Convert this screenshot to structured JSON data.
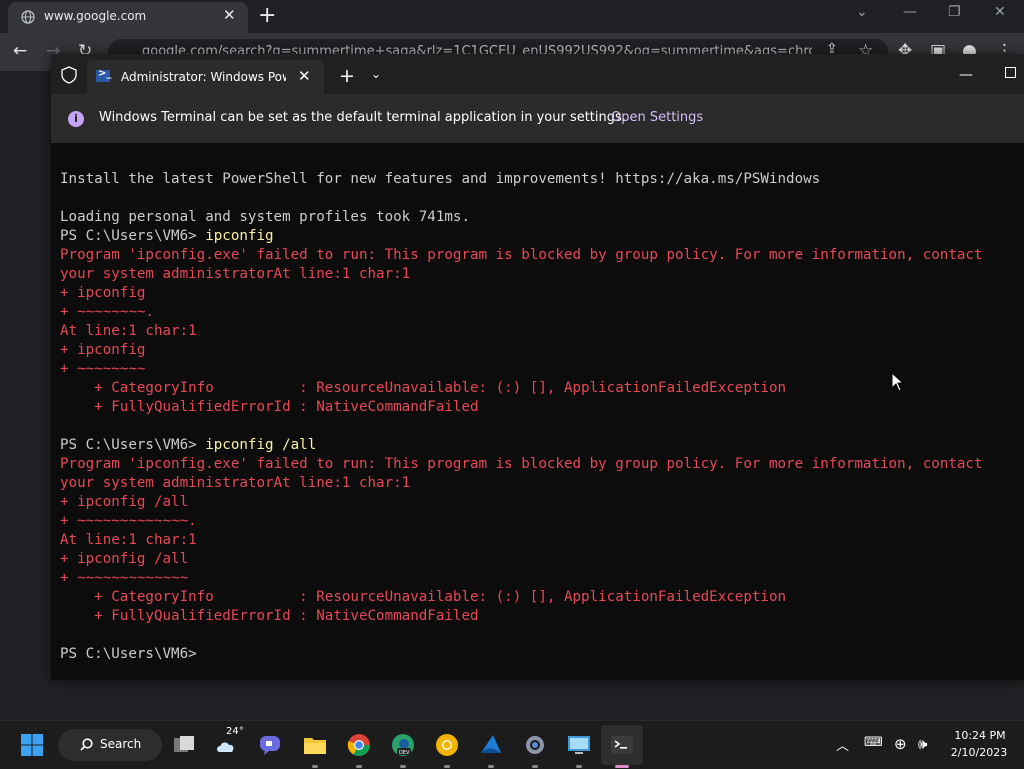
{
  "browser": {
    "tab_title": "www.google.com",
    "url": "google.com/search?q=summertime+saga&rlz=1C1GCEU_enUS992US992&oq=summertime&aqs=chrome",
    "colors": {
      "frame": "#202124",
      "toolbar": "#35363a"
    }
  },
  "terminal": {
    "tab_title": "Administrator: Windows PowerShell",
    "infobar": {
      "message": "Windows Terminal can be set as the default terminal application in your settings.",
      "link": "Open Settings"
    },
    "lines": [
      {
        "t": "Install the latest PowerShell for new features and improvements! https://aka.ms/PSWindows",
        "c": "w"
      },
      {
        "t": "",
        "c": "w"
      },
      {
        "t": "Loading personal and system profiles took 741ms.",
        "c": "w"
      },
      {
        "t": "PS C:\\Users\\VM6> ",
        "c": "w",
        "cmd": "ipconfig"
      },
      {
        "t": "Program 'ipconfig.exe' failed to run: This program is blocked by group policy. For more information, contact",
        "c": "r"
      },
      {
        "t": "your system administratorAt line:1 char:1",
        "c": "r"
      },
      {
        "t": "+ ipconfig",
        "c": "r"
      },
      {
        "t": "+ ~~~~~~~~.",
        "c": "r"
      },
      {
        "t": "At line:1 char:1",
        "c": "r"
      },
      {
        "t": "+ ipconfig",
        "c": "r"
      },
      {
        "t": "+ ~~~~~~~~",
        "c": "r"
      },
      {
        "t": "    + CategoryInfo          : ResourceUnavailable: (:) [], ApplicationFailedException",
        "c": "r"
      },
      {
        "t": "    + FullyQualifiedErrorId : NativeCommandFailed",
        "c": "r"
      },
      {
        "t": "",
        "c": "w"
      },
      {
        "t": "PS C:\\Users\\VM6> ",
        "c": "w",
        "cmd": "ipconfig /all"
      },
      {
        "t": "Program 'ipconfig.exe' failed to run: This program is blocked by group policy. For more information, contact",
        "c": "r"
      },
      {
        "t": "your system administratorAt line:1 char:1",
        "c": "r"
      },
      {
        "t": "+ ipconfig /all",
        "c": "r"
      },
      {
        "t": "+ ~~~~~~~~~~~~~.",
        "c": "r"
      },
      {
        "t": "At line:1 char:1",
        "c": "r"
      },
      {
        "t": "+ ipconfig /all",
        "c": "r"
      },
      {
        "t": "+ ~~~~~~~~~~~~~",
        "c": "r"
      },
      {
        "t": "    + CategoryInfo          : ResourceUnavailable: (:) [], ApplicationFailedException",
        "c": "r"
      },
      {
        "t": "    + FullyQualifiedErrorId : NativeCommandFailed",
        "c": "r"
      },
      {
        "t": "",
        "c": "w"
      },
      {
        "t": "PS C:\\Users\\VM6> ",
        "c": "w"
      }
    ],
    "colors": {
      "background": "#0c0c0c",
      "text": "#cccccc",
      "error": "#e74856",
      "command": "#f9f1a5"
    }
  },
  "taskbar": {
    "search_label": "Search",
    "weather_temp": "24°",
    "clock_time": "10:24 PM",
    "clock_date": "2/10/2023",
    "icons": [
      "start-icon",
      "search-icon",
      "task-view-icon",
      "weather-icon",
      "chat-icon",
      "file-explorer-icon",
      "chrome-icon",
      "edge-dev-icon",
      "chrome-canary-icon",
      "azure-data-studio-icon",
      "settings-icon",
      "remote-desktop-icon",
      "windows-terminal-icon"
    ]
  }
}
